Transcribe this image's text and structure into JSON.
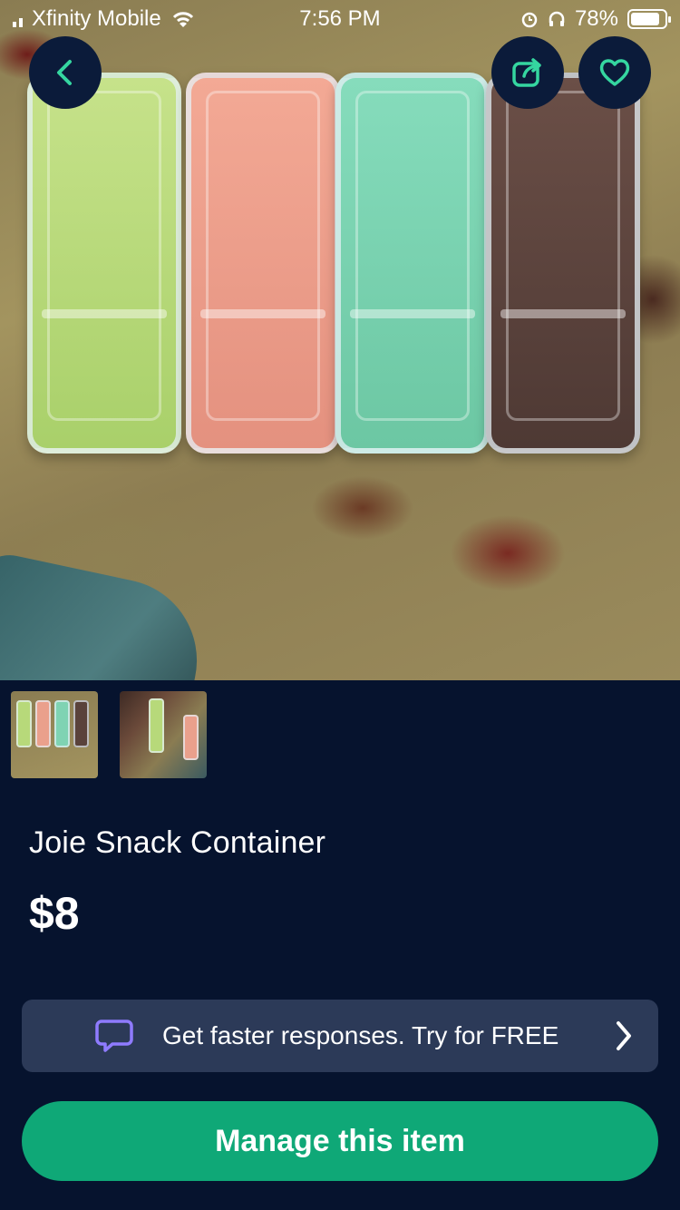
{
  "status_bar": {
    "carrier": "Xfinity Mobile",
    "time": "7:56 PM",
    "battery": "78%"
  },
  "icons": {
    "back": "back-icon",
    "share": "share-icon",
    "favorite": "heart-icon",
    "chat": "chat-bubble-icon",
    "chevron": "chevron-right-icon"
  },
  "listing": {
    "title": "Joie Snack Container",
    "price": "$8"
  },
  "promo": {
    "label": "Get faster responses.  Try for FREE"
  },
  "actions": {
    "manage_label": "Manage this item"
  },
  "colors": {
    "background": "#06132e",
    "accent_green": "#0fa877",
    "promo_bg": "#2c3a58",
    "share_icon": "#35d6a0"
  }
}
